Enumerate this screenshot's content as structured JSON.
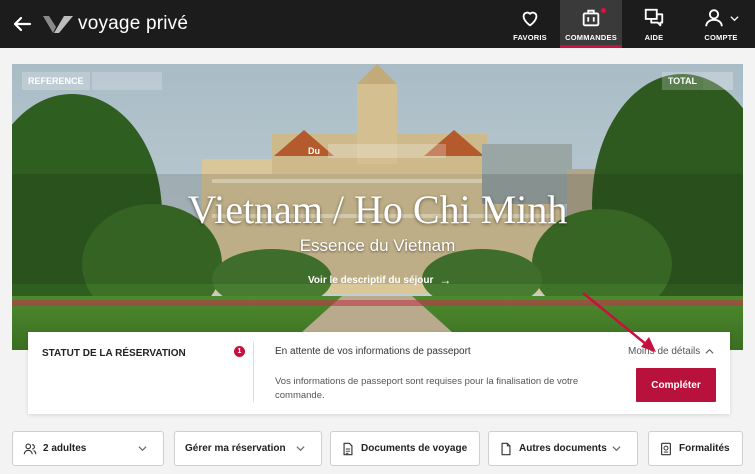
{
  "header": {
    "logo_text": "voyage privé",
    "nav": [
      {
        "label": "FAVORIS",
        "icon": "heart-icon"
      },
      {
        "label": "COMMANDES",
        "icon": "suitcase-icon",
        "active": true,
        "notification": true
      },
      {
        "label": "AIDE",
        "icon": "chat-icon"
      },
      {
        "label": "COMPTE",
        "icon": "user-icon"
      }
    ]
  },
  "hero": {
    "reference_label": "REFERENCE",
    "total_label": "TOTAL",
    "du_label": "Du",
    "destination": "Vietnam / Ho Chi Minh",
    "subtitle": "Essence du Vietnam",
    "description_link": "Voir le descriptif du séjour"
  },
  "status": {
    "title": "STATUT DE LA RÉSERVATION",
    "count": "1",
    "message": "En attente de vos informations de passeport",
    "details_link": "Moins de détails",
    "description": "Vos informations de passeport sont requises pour la finalisation de votre commande.",
    "button": "Compléter"
  },
  "actions": {
    "travelers": "2 adultes",
    "manage": "Gérer ma réservation",
    "travel_docs": "Documents de voyage",
    "other_docs": "Autres documents",
    "formalities": "Formalités"
  },
  "colors": {
    "header_bg": "#1c1c1c",
    "accent": "#c8103e",
    "button": "#b8123c"
  }
}
